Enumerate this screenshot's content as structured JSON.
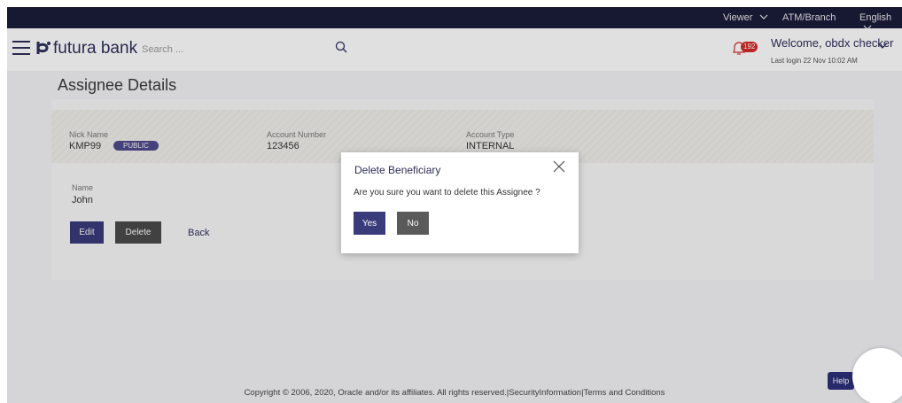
{
  "topbar": {
    "viewer": "Viewer",
    "atm_branch": "ATM/Branch",
    "language": "English"
  },
  "header": {
    "logo_text": "futura bank",
    "search_placeholder": "Search ...",
    "notification_count": "192",
    "welcome": "Welcome, obdx checker",
    "last_login": "Last login 22 Nov 10:02 AM"
  },
  "page": {
    "title": "Assignee Details"
  },
  "details": {
    "nick_name_label": "Nick Name",
    "nick_name_value": "KMP99",
    "public_badge": "PUBLIC",
    "account_number_label": "Account Number",
    "account_number_value": "123456",
    "account_type_label": "Account Type",
    "account_type_value": "INTERNAL",
    "name_label": "Name",
    "name_value": "John"
  },
  "actions": {
    "edit": "Edit",
    "delete": "Delete",
    "back": "Back"
  },
  "modal": {
    "title": "Delete Beneficiary",
    "message": "Are you sure you want to delete this Assignee ?",
    "yes": "Yes",
    "no": "No"
  },
  "help": {
    "label": "Help"
  },
  "footer": {
    "copyright": "Copyright © 2006, 2020, Oracle and/or its affiliates. All rights reserved.|SecurityInformation|Terms and Conditions"
  },
  "colors": {
    "navy": "#2e2f5a",
    "topbar": "#1b1c3a",
    "badge_red": "#d62b2b",
    "public_badge": "#4e4a8c",
    "primary_button": "#3a3b7a",
    "secondary_button": "#4a4a4a"
  }
}
